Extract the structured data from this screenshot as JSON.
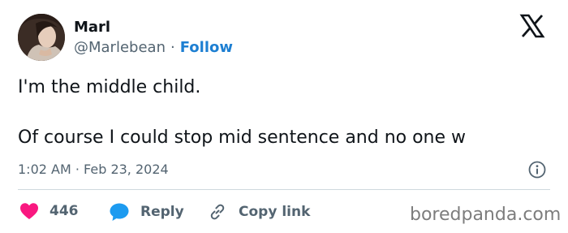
{
  "author": {
    "name": "Marl",
    "handle": "@Marlebean",
    "separator": "·",
    "follow_label": "Follow"
  },
  "tweet": {
    "lines": [
      "I'm the middle child.",
      "Of course I could stop mid sentence and no one w"
    ],
    "timestamp": "1:02 AM · Feb 23, 2024"
  },
  "actions": {
    "like_count": "446",
    "reply_label": "Reply",
    "copy_label": "Copy link"
  },
  "watermark": "boredpanda.com",
  "colors": {
    "text": "#0f1419",
    "muted": "#536471",
    "link": "#1d7fd2",
    "like": "#f91880",
    "reply": "#1d9bf0",
    "divider": "#cfd9de"
  },
  "icons": {
    "brand": "x-logo-icon",
    "info": "info-icon",
    "like": "heart-icon",
    "reply": "speech-bubble-icon",
    "copy": "link-icon"
  }
}
